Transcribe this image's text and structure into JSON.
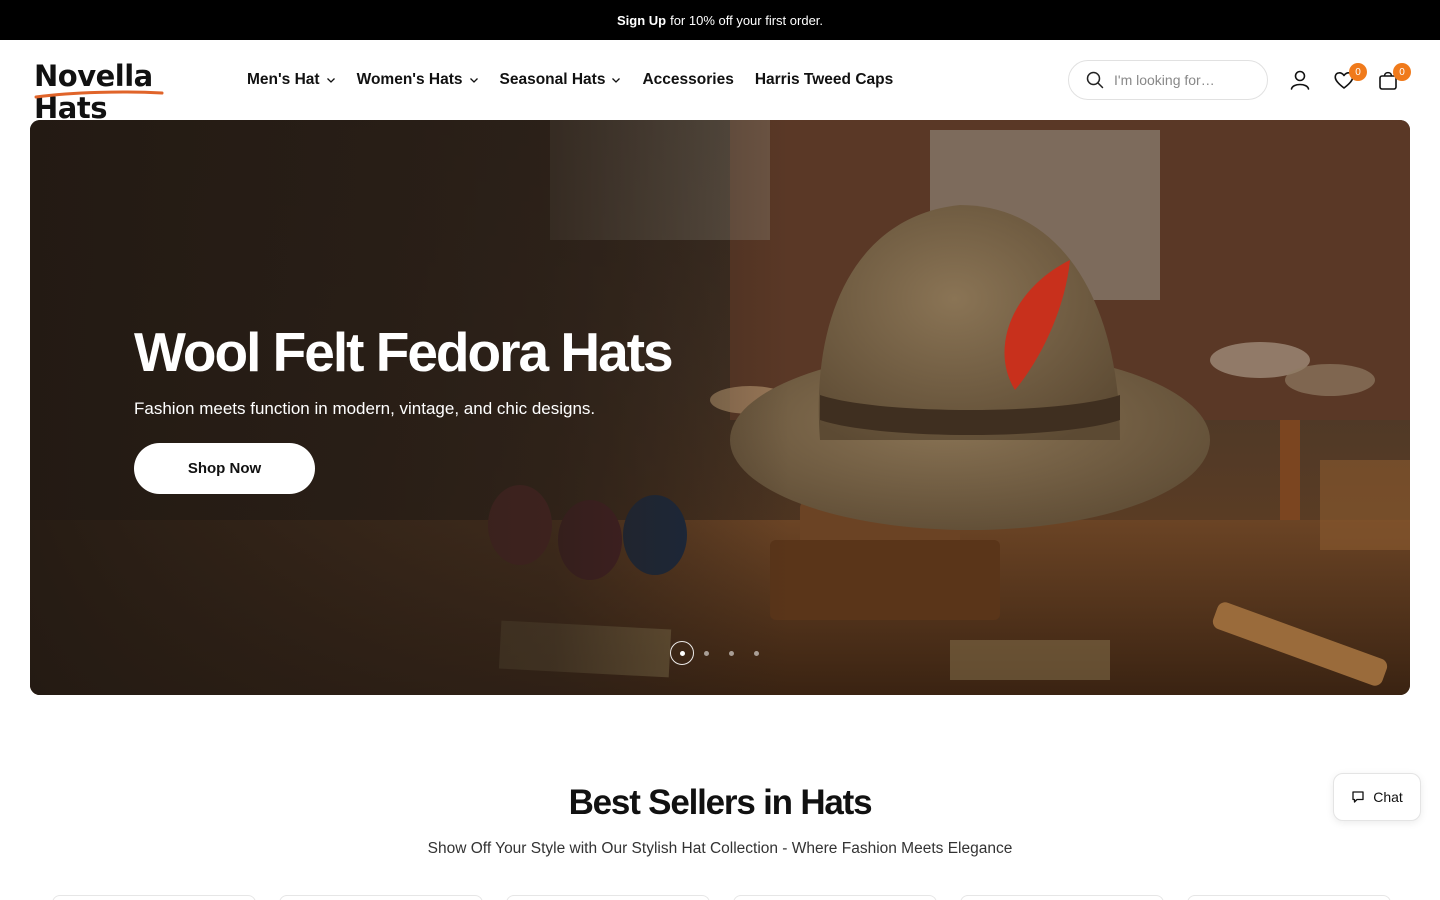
{
  "announcement": {
    "strong": "Sign Up",
    "text": "for 10% off your first order."
  },
  "brand": {
    "logo_text": "Novella Hats",
    "accent": "#e0642a"
  },
  "nav": {
    "items": [
      {
        "label": "Men's Hat",
        "has_dropdown": true
      },
      {
        "label": "Women's Hats",
        "has_dropdown": true
      },
      {
        "label": "Seasonal Hats",
        "has_dropdown": true
      },
      {
        "label": "Accessories",
        "has_dropdown": false
      },
      {
        "label": "Harris Tweed Caps",
        "has_dropdown": false
      }
    ]
  },
  "search": {
    "placeholder": "I'm looking for…",
    "icon": "search-icon"
  },
  "header_icons": {
    "account": "user-icon",
    "wishlist": {
      "icon": "heart-icon",
      "count": "0"
    },
    "cart": {
      "icon": "bag-icon",
      "count": "0"
    },
    "badge_color": "#f07a1b"
  },
  "hero": {
    "title": "Wool Felt Fedora Hats",
    "subtitle": "Fashion meets function in modern, vintage, and chic designs.",
    "cta": "Shop Now",
    "slides": 4,
    "active_slide": 1
  },
  "best_sellers": {
    "title": "Best Sellers in Hats",
    "subtitle": "Show Off Your Style with Our Stylish Hat Collection - Where Fashion Meets Elegance"
  },
  "chat": {
    "label": "Chat",
    "icon": "chat-bubble-icon"
  }
}
